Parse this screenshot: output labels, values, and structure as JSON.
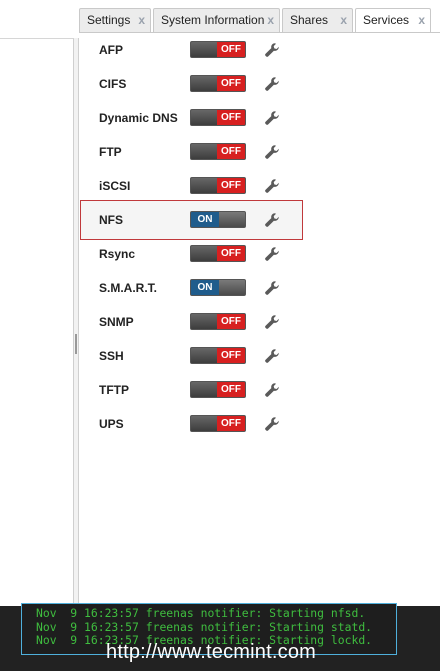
{
  "tabs": [
    {
      "label": "Settings",
      "active": false
    },
    {
      "label": "System Information",
      "active": false
    },
    {
      "label": "Shares",
      "active": false
    },
    {
      "label": "Services",
      "active": true
    }
  ],
  "tab_close_glyph": "x",
  "services": [
    {
      "name": "AFP",
      "state": "OFF"
    },
    {
      "name": "CIFS",
      "state": "OFF"
    },
    {
      "name": "Dynamic DNS",
      "state": "OFF"
    },
    {
      "name": "FTP",
      "state": "OFF"
    },
    {
      "name": "iSCSI",
      "state": "OFF"
    },
    {
      "name": "NFS",
      "state": "ON"
    },
    {
      "name": "Rsync",
      "state": "OFF"
    },
    {
      "name": "S.M.A.R.T.",
      "state": "ON"
    },
    {
      "name": "SNMP",
      "state": "OFF"
    },
    {
      "name": "SSH",
      "state": "OFF"
    },
    {
      "name": "TFTP",
      "state": "OFF"
    },
    {
      "name": "UPS",
      "state": "OFF"
    }
  ],
  "settings_icon": "wrench-icon",
  "highlighted_service": "NFS",
  "terminal": {
    "lines": [
      "Nov  9 16:23:57 freenas notifier: Starting nfsd.",
      "Nov  9 16:23:57 freenas notifier: Starting statd.",
      "Nov  9 16:23:57 freenas notifier: Starting lockd."
    ]
  },
  "watermark": "http://www.tecmint.com",
  "colors": {
    "off": "#d72020",
    "on": "#1f5c8c",
    "highlight_border": "#c0393b",
    "terminal_border": "#4fb0dc",
    "terminal_text": "#3fbd3f"
  }
}
